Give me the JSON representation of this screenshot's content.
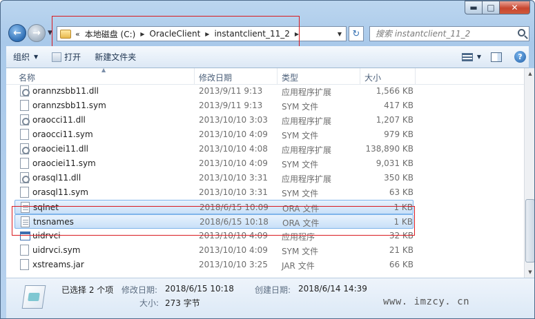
{
  "window": {
    "controls": {
      "minimize": "▬",
      "maximize": "□",
      "close": "✕"
    }
  },
  "nav": {
    "address_overflow": "«",
    "breadcrumbs": [
      "本地磁盘 (C:)",
      "OracleClient",
      "instantclient_11_2"
    ],
    "search_placeholder": "搜索 instantclient_11_2"
  },
  "toolbar": {
    "organize": "组织",
    "open": "打开",
    "new_folder": "新建文件夹"
  },
  "columns": {
    "name": "名称",
    "date": "修改日期",
    "type": "类型",
    "size": "大小"
  },
  "files": [
    {
      "name": "orannzsbb11.dll",
      "date": "2013/9/11 9:13",
      "type": "应用程序扩展",
      "size": "1,566 KB",
      "icon": "dll-file-icon",
      "selected": false
    },
    {
      "name": "orannzsbb11.sym",
      "date": "2013/9/11 9:13",
      "type": "SYM 文件",
      "size": "417 KB",
      "icon": "generic-file-icon",
      "selected": false
    },
    {
      "name": "oraocci11.dll",
      "date": "2013/10/10 3:03",
      "type": "应用程序扩展",
      "size": "1,207 KB",
      "icon": "dll-file-icon",
      "selected": false
    },
    {
      "name": "oraocci11.sym",
      "date": "2013/10/10 4:09",
      "type": "SYM 文件",
      "size": "979 KB",
      "icon": "generic-file-icon",
      "selected": false
    },
    {
      "name": "oraociei11.dll",
      "date": "2013/10/10 4:08",
      "type": "应用程序扩展",
      "size": "138,890 KB",
      "icon": "dll-file-icon",
      "selected": false
    },
    {
      "name": "oraociei11.sym",
      "date": "2013/10/10 4:09",
      "type": "SYM 文件",
      "size": "9,031 KB",
      "icon": "generic-file-icon",
      "selected": false
    },
    {
      "name": "orasql11.dll",
      "date": "2013/10/10 3:31",
      "type": "应用程序扩展",
      "size": "350 KB",
      "icon": "dll-file-icon",
      "selected": false
    },
    {
      "name": "orasql11.sym",
      "date": "2013/10/10 3:31",
      "type": "SYM 文件",
      "size": "63 KB",
      "icon": "generic-file-icon",
      "selected": false
    },
    {
      "name": "sqlnet",
      "date": "2018/6/15 10:09",
      "type": "ORA 文件",
      "size": "1 KB",
      "icon": "ora-file-icon",
      "selected": true
    },
    {
      "name": "tnsnames",
      "date": "2018/6/15 10:18",
      "type": "ORA 文件",
      "size": "1 KB",
      "icon": "ora-file-icon",
      "selected": true
    },
    {
      "name": "uidrvci",
      "date": "2013/10/10 4:09",
      "type": "应用程序",
      "size": "32 KB",
      "icon": "exe-file-icon",
      "selected": false
    },
    {
      "name": "uidrvci.sym",
      "date": "2013/10/10 4:09",
      "type": "SYM 文件",
      "size": "21 KB",
      "icon": "generic-file-icon",
      "selected": false
    },
    {
      "name": "xstreams.jar",
      "date": "2013/10/10 3:25",
      "type": "JAR 文件",
      "size": "66 KB",
      "icon": "generic-file-icon",
      "selected": false
    }
  ],
  "details": {
    "selected_text": "已选择 2 个项",
    "modified_label": "修改日期:",
    "modified_value": "2018/6/15 10:18",
    "created_label": "创建日期:",
    "created_value": "2018/6/14 14:39",
    "size_label": "大小:",
    "size_value": "273 字节",
    "watermark": "www. imzcy. cn"
  }
}
